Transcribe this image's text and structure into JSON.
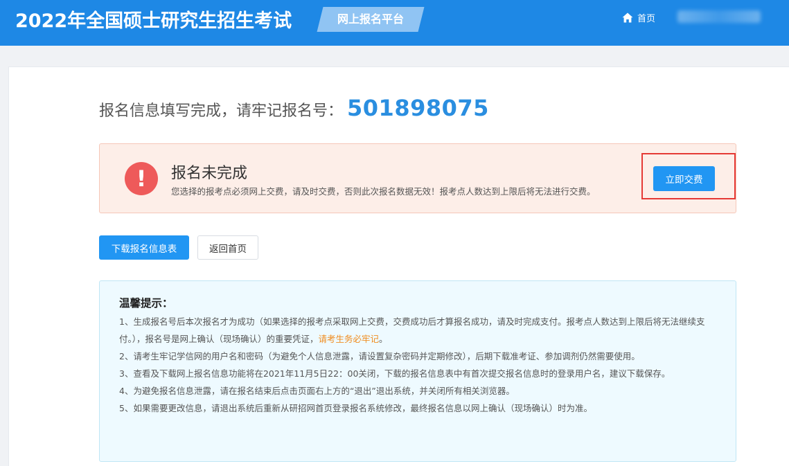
{
  "header": {
    "title": "2022年全国硕士研究生招生考试",
    "platform_label": "网上报名平台",
    "home_label": "首页",
    "home_icon": "home-icon"
  },
  "registration": {
    "message": "报名信息填写完成，请牢记报名号：",
    "number": "501898075"
  },
  "alert": {
    "icon": "exclamation-icon",
    "title": "报名未完成",
    "description": "您选择的报考点必须网上交费，请及时交费，否则此次报名数据无效！报考点人数达到上限后将无法进行交费。",
    "pay_button": "立即交费"
  },
  "actions": {
    "download_label": "下载报名信息表",
    "back_label": "返回首页"
  },
  "tips": {
    "title": "温馨提示：",
    "item1_part1": "1、生成报名号后本次报名才为成功（如果选择的报考点采取网上交费，交费成功后才算报名成功，请及时完成支付。报考点人数达到上限后将无法继续支付。），报名号是网上确认（现场确认）的重要凭证，",
    "item1_highlight": "请考生务必牢记",
    "item1_part2": "。",
    "item2": "2、请考生牢记学信网的用户名和密码（为避免个人信息泄露，请设置复杂密码并定期修改），后期下载准考证、参加调剂仍然需要使用。",
    "item3": "3、查看及下载网上报名信息功能将在2021年11月5日22：00关闭，下载的报名信息表中有首次提交报名信息时的登录用户名，建议下载保存。",
    "item4": "4、为避免报名信息泄露，请在报名结束后点击页面右上方的“退出”退出系统，并关闭所有相关浏览器。",
    "item5": "5、如果需要更改信息，请退出系统后重新从研招网首页登录报名系统修改，最终报名信息以网上确认（现场确认）时为准。"
  },
  "colors": {
    "header_bg": "#1e88e5",
    "primary": "#2196f3",
    "reg_number": "#2a8ee0",
    "alert_bg": "#fdeee8",
    "alert_icon": "#ee5a5a",
    "highlight": "#f08c1e",
    "annotation_frame": "#e53935"
  }
}
